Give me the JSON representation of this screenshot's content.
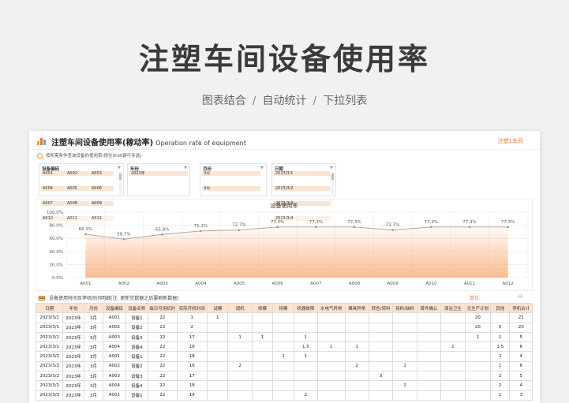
{
  "hero": {
    "title": "注塑车间设备使用率",
    "features": [
      "图表结合",
      "自动统计",
      "下拉列表"
    ],
    "separator": "/"
  },
  "sheet": {
    "title": "注塑车间设备使用率(稼动率)",
    "title_en": "Operation rate of equipment",
    "tag": "注塑1车间",
    "hint": "按所需条件查询设备的使用率(按住Shift键可多选)"
  },
  "slicers": [
    {
      "label": "设备编码",
      "items": [
        "A001",
        "A002",
        "A003",
        "A004",
        "A005",
        "A006",
        "A007",
        "A008",
        "A009",
        "A010",
        "A011",
        "A012"
      ]
    },
    {
      "label": "年份",
      "items": [
        "2023年"
      ]
    },
    {
      "label": "月份",
      "items": [
        "3月",
        "4月"
      ]
    },
    {
      "label": "日期",
      "items": [
        "2023/3/1",
        "2023/3/2",
        "2023/3/3",
        "2023/3/4"
      ]
    }
  ],
  "chart_data": {
    "type": "line",
    "title": "设备使用率",
    "categories": [
      "A001",
      "A002",
      "A003",
      "A004",
      "A005",
      "A006",
      "A007",
      "A008",
      "A009",
      "A010",
      "A011",
      "A012"
    ],
    "values": [
      66.3,
      58.7,
      65.9,
      71.2,
      72.7,
      77.3,
      77.3,
      77.3,
      72.7,
      77.3,
      77.3,
      77.3
    ],
    "data_labels": [
      "66.3%",
      "58.7%",
      "65.9%",
      "71.2%",
      "72.7%",
      "77.3%",
      "77.3%",
      "77.3%",
      "72.7%",
      "77.3%",
      "77.3%",
      "77.3%"
    ],
    "y_ticks": [
      "0.0%",
      "20.0%",
      "40.0%",
      "60.0%",
      "80.0%",
      "100.0%"
    ],
    "ylim": [
      0,
      100
    ],
    "grid": true,
    "line_color": "#aaaaaa",
    "area_color": "#f7a56b"
  },
  "table": {
    "caption": "设备使用时间及停机时间明细(注: 更新完数据之后要刷新数据)",
    "unit_label": "单位:",
    "unit_value": "H",
    "headers": [
      "日期",
      "年份",
      "月份",
      "设备编码",
      "设备名称",
      "每日可用机时",
      "实际开机时间",
      "试模",
      "调机",
      "修模",
      "待模",
      "机器故障",
      "水电气异常",
      "模具异常",
      "转色/转料",
      "待料/缺料",
      "首件确认",
      "清洁卫生",
      "无生产计划",
      "其他",
      "停机合计"
    ],
    "rows": [
      [
        "2023/3/1",
        "2023年",
        "3月",
        "A001",
        "设备1",
        "22",
        "1",
        "1",
        "",
        "",
        "",
        "",
        "",
        "",
        "",
        "",
        "",
        "",
        "20",
        "",
        "21"
      ],
      [
        "2023/3/1",
        "2023年",
        "3月",
        "A002",
        "设备2",
        "22",
        "2",
        "",
        "",
        "",
        "",
        "",
        "",
        "",
        "",
        "",
        "",
        "",
        "20",
        "0",
        "20"
      ],
      [
        "2023/3/1",
        "2023年",
        "3月",
        "A003",
        "设备3",
        "22",
        "17",
        "",
        "1",
        "1",
        "",
        "1",
        "",
        "",
        "",
        "",
        "",
        "",
        "1",
        "1",
        "5"
      ],
      [
        "2023/3/1",
        "2023年",
        "3月",
        "A004",
        "设备4",
        "22",
        "16",
        "",
        "",
        "",
        "",
        "1.5",
        "1",
        "1",
        "",
        "",
        "",
        "1",
        "",
        "1.5",
        "6"
      ],
      [
        "2023/3/2",
        "2023年",
        "3月",
        "A001",
        "设备1",
        "22",
        "18",
        "",
        "",
        "",
        "1",
        "1",
        "",
        "",
        "",
        "",
        "",
        "",
        "",
        "2",
        "4"
      ],
      [
        "2023/3/2",
        "2023年",
        "3月",
        "A002",
        "设备2",
        "22",
        "16",
        "",
        "2",
        "",
        "",
        "",
        "",
        "2",
        "",
        "1",
        "",
        "",
        "",
        "1",
        "6"
      ],
      [
        "2023/3/2",
        "2023年",
        "3月",
        "A003",
        "设备3",
        "22",
        "17",
        "",
        "",
        "",
        "",
        "",
        "",
        "",
        "3",
        "",
        "",
        "",
        "",
        "2",
        "5"
      ],
      [
        "2023/3/2",
        "2023年",
        "3月",
        "A004",
        "设备4",
        "22",
        "18",
        "",
        "",
        "",
        "",
        "",
        "",
        "",
        "",
        "2",
        "",
        "",
        "",
        "2",
        "4"
      ],
      [
        "2023/3/3",
        "2023年",
        "3月",
        "A001",
        "设备1",
        "22",
        "19",
        "",
        "",
        "",
        "",
        "2",
        "",
        "",
        "",
        "",
        "",
        "",
        "",
        "1",
        "3"
      ]
    ]
  }
}
